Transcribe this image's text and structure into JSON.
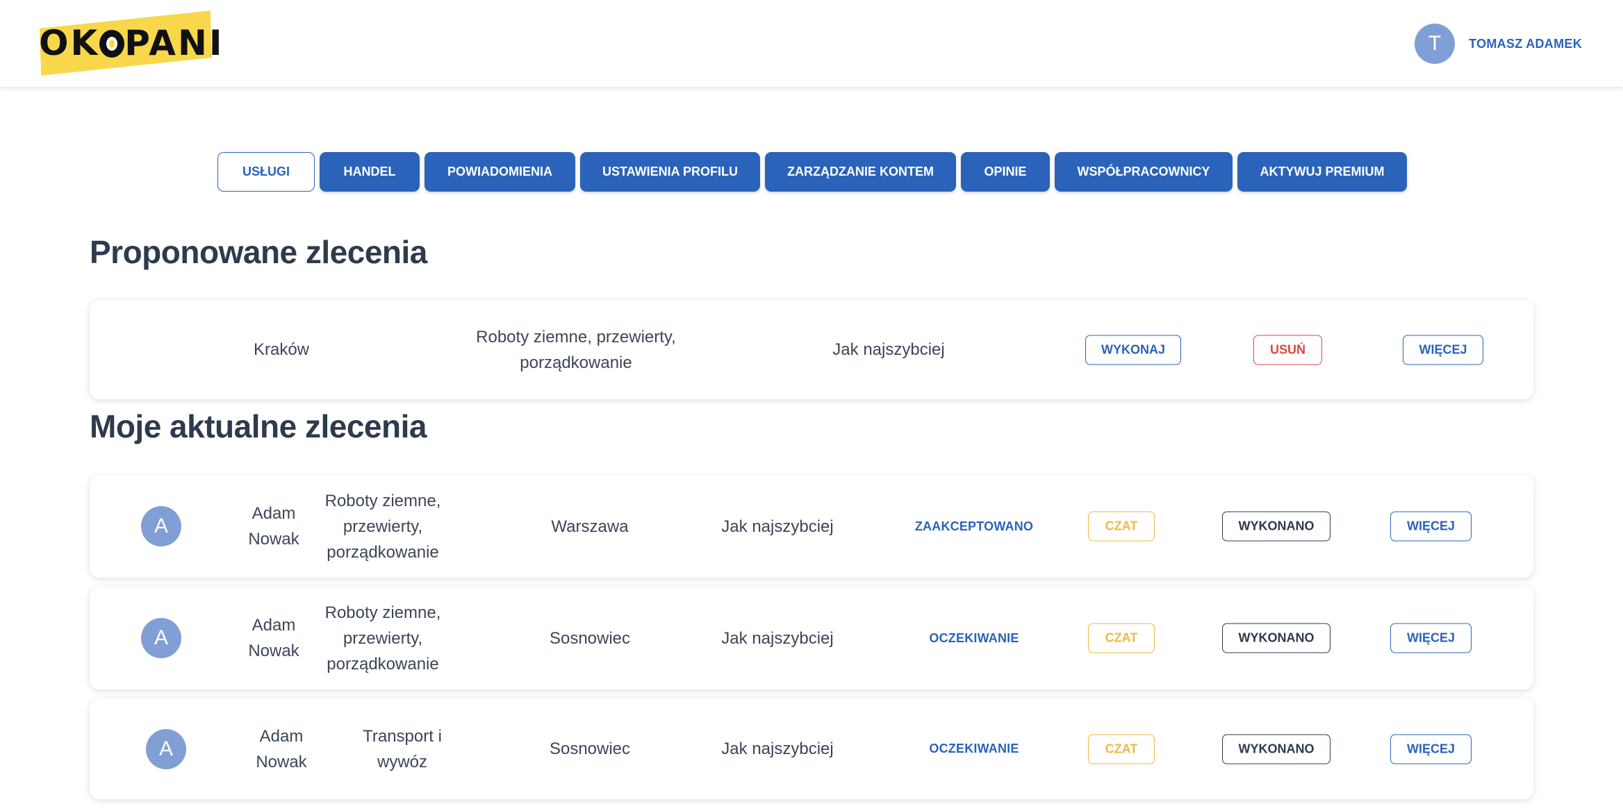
{
  "header": {
    "logo_text": "OKOPANI",
    "user": {
      "avatar_initial": "T",
      "name": "TOMASZ ADAMEK"
    }
  },
  "tabs": [
    {
      "label": "USŁUGI",
      "active": true
    },
    {
      "label": "HANDEL",
      "active": false
    },
    {
      "label": "POWIADOMIENIA",
      "active": false
    },
    {
      "label": "USTAWIENIA PROFILU",
      "active": false
    },
    {
      "label": "ZARZĄDZANIE KONTEM",
      "active": false
    },
    {
      "label": "OPINIE",
      "active": false
    },
    {
      "label": "WSPÓŁPRACOWNICY",
      "active": false
    },
    {
      "label": "AKTYWUJ PREMIUM",
      "active": false
    }
  ],
  "proposed": {
    "title": "Proponowane zlecenia",
    "items": [
      {
        "city": "Kraków",
        "service": "Roboty ziemne, przewierty, porządkowanie",
        "time": "Jak najszybciej",
        "execute_label": "WYKONAJ",
        "delete_label": "USUŃ",
        "more_label": "WIĘCEJ"
      }
    ]
  },
  "current": {
    "title": "Moje aktualne zlecenia",
    "items": [
      {
        "avatar_initial": "A",
        "client": "Adam Nowak",
        "service": "Roboty ziemne, przewierty, porządkowanie",
        "city": "Warszawa",
        "time": "Jak najszybciej",
        "status": "ZAAKCEPTOWANO",
        "chat_label": "CZAT",
        "done_label": "WYKONANO",
        "more_label": "WIĘCEJ"
      },
      {
        "avatar_initial": "A",
        "client": "Adam Nowak",
        "service": "Roboty ziemne, przewierty, porządkowanie",
        "city": "Sosnowiec",
        "time": "Jak najszybciej",
        "status": "OCZEKIWANIE",
        "chat_label": "CZAT",
        "done_label": "WYKONANO",
        "more_label": "WIĘCEJ"
      },
      {
        "avatar_initial": "A",
        "client": "Adam Nowak",
        "service": "Transport i wywóz",
        "city": "Sosnowiec",
        "time": "Jak najszybciej",
        "status": "OCZEKIWANIE",
        "chat_label": "CZAT",
        "done_label": "WYKONANO",
        "more_label": "WIĘCEJ"
      }
    ]
  },
  "colors": {
    "primary": "#2a63b9",
    "danger": "#e2453c",
    "warning": "#f1b743",
    "dark": "#2e3a4d",
    "avatar": "#7f9fd5",
    "logo_yellow": "#f8d84a"
  }
}
